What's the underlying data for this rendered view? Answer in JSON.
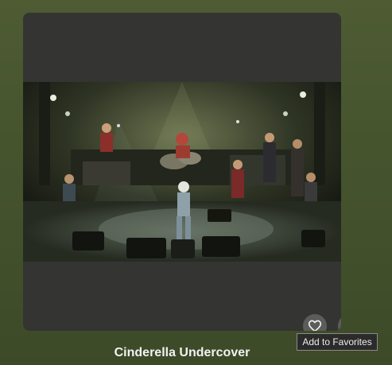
{
  "album": {
    "title": "Cinderella Undercover",
    "artwork_icon": "concert-stage-photo"
  },
  "actions": {
    "favorite_icon": "heart-outline-icon",
    "more_icon": "more-horizontal-icon"
  },
  "tooltip": {
    "text": "Add to Favorites"
  },
  "colors": {
    "background": "#4a5630",
    "card": "#343432",
    "button": "#5c5c5a",
    "title_text": "#f2f2f2"
  }
}
